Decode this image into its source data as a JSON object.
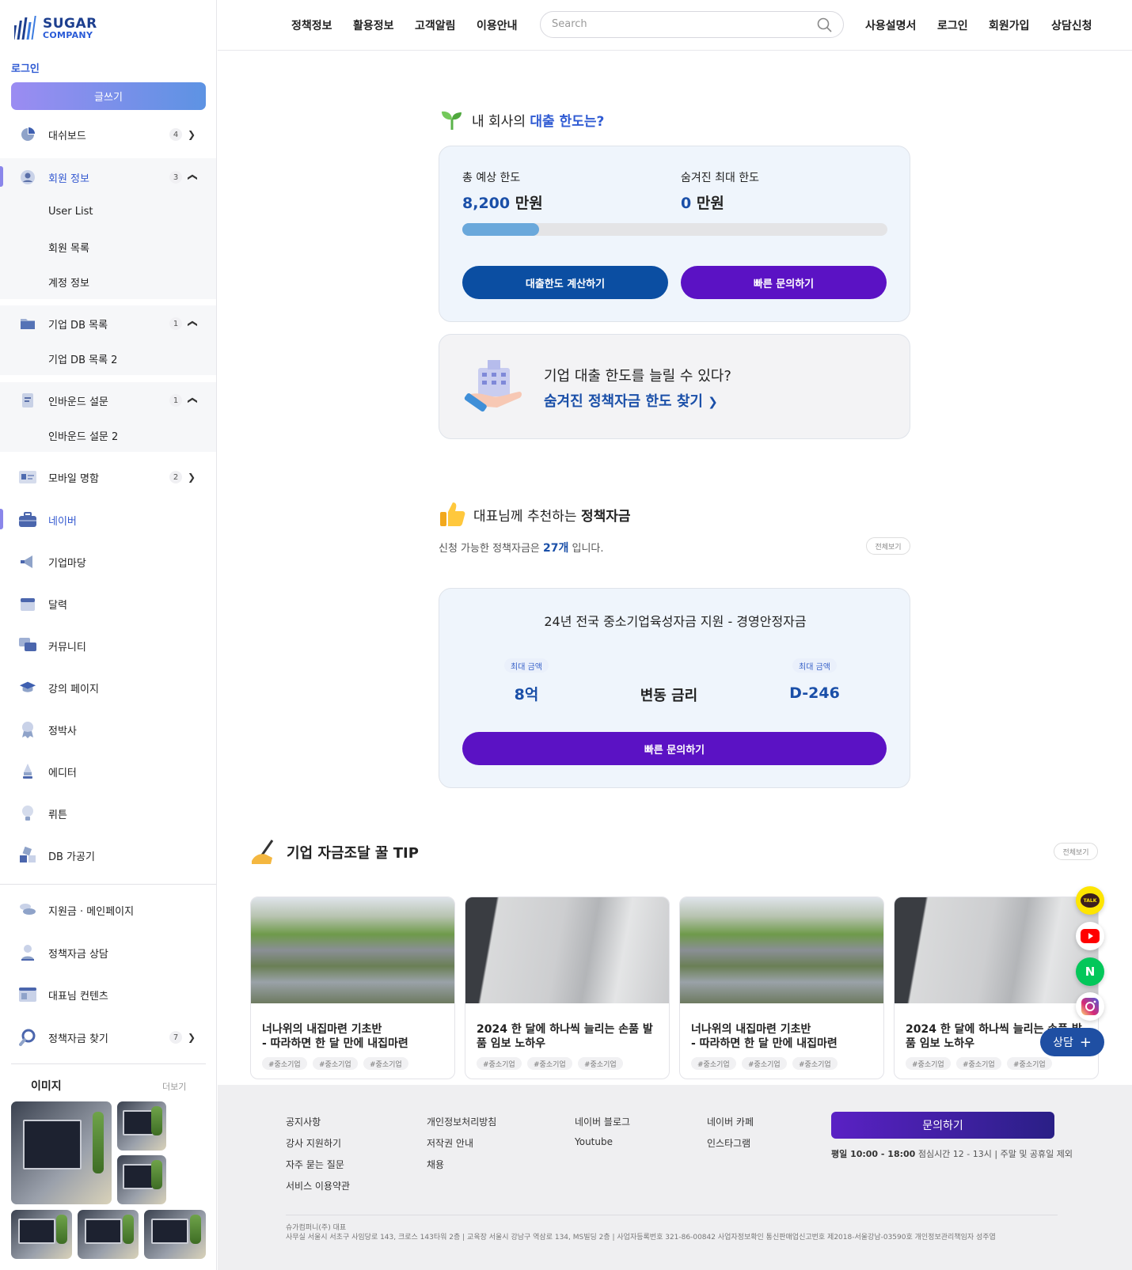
{
  "brand": {
    "name_line1": "SUGAR",
    "name_line2": "COMPANY"
  },
  "sidebar": {
    "login": "로그인",
    "write_button": "글쓰기",
    "items": [
      {
        "label": "대쉬보드",
        "badge": "4",
        "icon": "pie-chart-icon"
      },
      {
        "label": "회원 정보",
        "badge": "3",
        "icon": "user-icon",
        "active": true,
        "expanded": true,
        "children": [
          "User List",
          "회원 목록",
          "계정 정보"
        ]
      },
      {
        "label": "기업 DB 목록",
        "badge": "1",
        "icon": "folder-icon",
        "expanded": true,
        "children": [
          "기업 DB 목록 2"
        ]
      },
      {
        "label": "인바운드 설문",
        "badge": "1",
        "icon": "document-icon",
        "expanded": true,
        "children": [
          "인바운드 설문 2"
        ]
      },
      {
        "label": "모바일 명함",
        "badge": "2",
        "icon": "id-card-icon"
      },
      {
        "label": "네이버",
        "icon": "briefcase-icon",
        "active": true
      },
      {
        "label": "기업마당",
        "icon": "megaphone-icon"
      },
      {
        "label": "달력",
        "icon": "calendar-icon"
      },
      {
        "label": "커뮤니티",
        "icon": "chat-icon"
      },
      {
        "label": "강의 페이지",
        "icon": "graduation-cap-icon"
      },
      {
        "label": "정박사",
        "icon": "ribbon-icon"
      },
      {
        "label": "에디터",
        "icon": "pen-icon"
      },
      {
        "label": "뤼튼",
        "icon": "lightbulb-icon"
      },
      {
        "label": "DB 가공기",
        "icon": "cubes-icon"
      },
      {
        "label": "지원금 · 메인페이지",
        "icon": "coins-icon"
      },
      {
        "label": "정책자금 상담",
        "icon": "person-icon"
      },
      {
        "label": "대표님 컨텐츠",
        "icon": "window-icon"
      },
      {
        "label": "정책자금 찾기",
        "badge": "7",
        "icon": "search-icon"
      }
    ],
    "images": {
      "title": "이미지",
      "more": "더보기"
    }
  },
  "topbar": {
    "nav_left": [
      "정책정보",
      "활용정보",
      "고객알림",
      "이용안내"
    ],
    "search_placeholder": "Search",
    "nav_right": [
      "사용설명서",
      "로그인",
      "회원가입",
      "상담신청"
    ]
  },
  "loan": {
    "title_prefix": "내 회사의 ",
    "title_highlight": "대출 한도는?",
    "total_label": "총 예상 한도",
    "total_value": "8,200",
    "total_unit": " 만원",
    "hidden_label": "숨겨진 최대 한도",
    "hidden_value": "0",
    "hidden_unit": " 만원",
    "progress": 0.18,
    "btn_calc": "대출한도 계산하기",
    "btn_inquiry": "빠른 문의하기"
  },
  "promo": {
    "line1": "기업 대출 한도를 늘릴 수 있다?",
    "line2": "숨겨진 정책자금 한도 찾기"
  },
  "recommend": {
    "title_prefix": "대표님께 추천하는 ",
    "title_bold": "정책자금",
    "sub_prefix": "신청 가능한 정책자금은 ",
    "sub_count": "27개",
    "sub_suffix": " 입니다.",
    "view_all": "전체보기",
    "fund": {
      "title": "24년 전국 중소기업육성자금 지원 - 경영안정자금",
      "cols": [
        {
          "chip": "최대 금액",
          "value": "8억"
        },
        {
          "chip": "",
          "value": "변동 금리"
        },
        {
          "chip": "최대 금액",
          "value": "D-246"
        }
      ],
      "button": "빠른 문의하기"
    }
  },
  "tips": {
    "title": "기업 자금조달 꿀 TIP",
    "view_all": "전체보기",
    "cards": [
      {
        "line1": "너나위의 내집마련 기초반",
        "line2": "- 따라하면 한 달 만에 내집마련",
        "tags": [
          "#중소기업",
          "#중소기업",
          "#중소기업"
        ]
      },
      {
        "line1": "2024 한 달에 하나씩 늘리는 손품 발",
        "line2": "품 임보 노하우",
        "tags": [
          "#중소기업",
          "#중소기업",
          "#중소기업"
        ]
      },
      {
        "line1": "너나위의 내집마련 기초반",
        "line2": "- 따라하면 한 달 만에 내집마련",
        "tags": [
          "#중소기업",
          "#중소기업",
          "#중소기업"
        ]
      },
      {
        "line1": "2024 한 달에 하나씩 늘리는 손품 발",
        "line2": "품 임보 노하우",
        "tags": [
          "#중소기업",
          "#중소기업",
          "#중소기업"
        ]
      }
    ]
  },
  "floating": {
    "talk": "TALK",
    "consult": "상담",
    "consult_plus": "+"
  },
  "footer": {
    "col1": [
      "공지사항",
      "강사 지원하기",
      "자주 묻는 질문",
      "서비스 이용약관"
    ],
    "col2": [
      "개인정보처리방침",
      "저작권 안내",
      "채용"
    ],
    "col3": [
      "네이버 블로그",
      "Youtube"
    ],
    "col4": [
      "네이버 카페",
      "인스타그램"
    ],
    "button": "문의하기",
    "hours_bold": "평일 10:00 - 18:00",
    "hours_rest": "  점심시간 12 - 13시 | 주말 및 공휴일 제외",
    "company_line1": "슈가컴퍼니(주) 대표",
    "company_line2": "사무실 서울시 서초구 사임당로 143, 크로스 143타워 2층 | 교육장 서울시 강남구 역삼로 134, MS빌딩 2층 | 사업자등록번호 321-86-00842 사업자정보확인 통신판매업신고번호 제2018-서울강남-03590호 개인정보관리책임자 성주엽"
  },
  "colors": {
    "primary": "#0b4ea2",
    "purple": "#5b12c4",
    "accent_blue": "#2f5bd3"
  }
}
